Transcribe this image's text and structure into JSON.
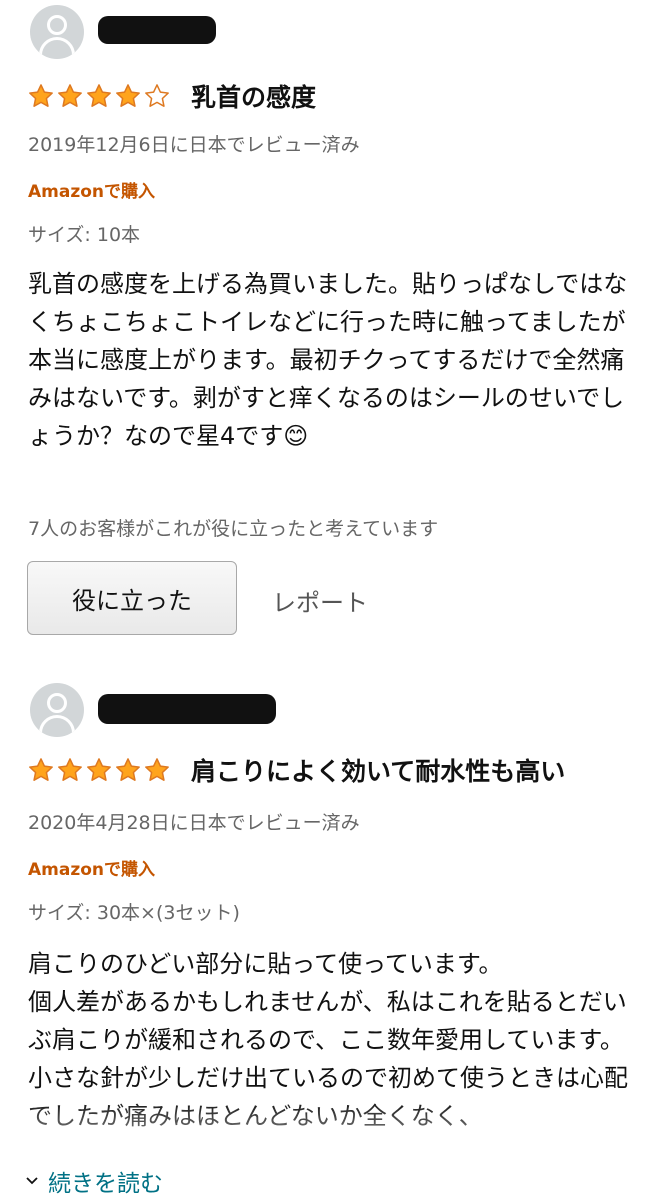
{
  "reviews": [
    {
      "rating": 4,
      "title": "乳首の感度",
      "date": "2019年12月6日に日本でレビュー済み",
      "verified": "Amazonで購入",
      "variant": "サイズ: 10本",
      "body": "乳首の感度を上げる為買いました。貼りっぱなしではなくちょこちょこトイレなどに行った時に触ってましたが本当に感度上がります。最初チクってするだけで全然痛みはないです。剥がすと痒くなるのはシールのせいでしょうか？なので星4です😊",
      "helpful_count": "7人のお客様がこれが役に立ったと考えています",
      "helpful_button": "役に立った",
      "report": "レポート"
    },
    {
      "rating": 5,
      "title": "肩こりによく効いて耐水性も高い",
      "date": "2020年4月28日に日本でレビュー済み",
      "verified": "Amazonで購入",
      "variant": "サイズ: 30本×(3セット)",
      "body_lines": [
        "肩こりのひどい部分に貼って使っています。",
        "個人差があるかもしれませんが、私はこれを貼るとだいぶ肩こりが緩和されるので、ここ数年愛用しています。",
        "小さな針が少しだけ出ているので初めて使うときは心配でしたが痛みはほとんどないか全くなく、"
      ]
    }
  ],
  "read_more": "続きを読む",
  "colors": {
    "star": "#ffa41c",
    "star_outline": "#de7921",
    "verified": "#c45500",
    "link": "#007185",
    "muted": "#666666"
  },
  "icons": {
    "avatar": "default-user-avatar-icon",
    "star_full": "star-filled-icon",
    "star_empty": "star-outline-icon",
    "chevron": "chevron-down-icon"
  }
}
